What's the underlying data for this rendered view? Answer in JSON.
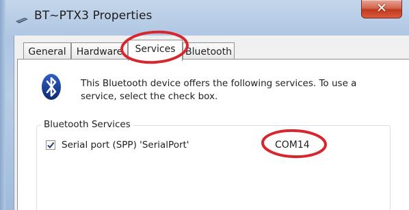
{
  "window": {
    "title": "BT~PTX3 Properties",
    "close_glyph": "✕",
    "app_icon": "bluetooth-device-icon"
  },
  "tabs": [
    {
      "label": "General",
      "active": false
    },
    {
      "label": "Hardware",
      "active": false
    },
    {
      "label": "Services",
      "active": true
    },
    {
      "label": "Bluetooth",
      "active": false
    }
  ],
  "services_panel": {
    "icon": "bluetooth-icon",
    "description": "This Bluetooth device offers the following services. To use a service, select the check box.",
    "group_title": "Bluetooth Services",
    "services": [
      {
        "label": "Serial port (SPP) 'SerialPort'",
        "checked": true,
        "port": "COM14"
      }
    ]
  },
  "annotations": {
    "highlight_color": "#d7262e",
    "highlighted": [
      "Services",
      "COM14"
    ]
  },
  "colors": {
    "frame": "#aec6e2",
    "close_button": "#c0391f",
    "bluetooth_badge": "#1b3f9c"
  }
}
